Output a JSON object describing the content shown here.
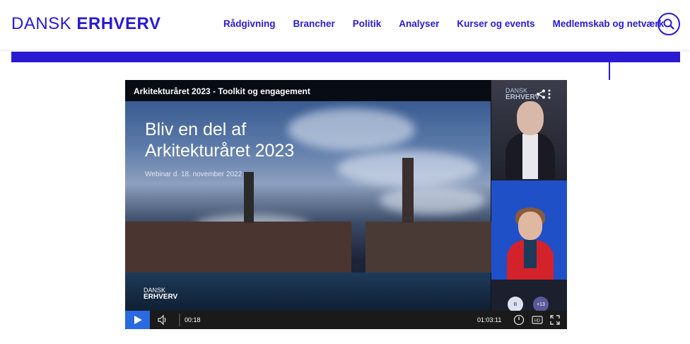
{
  "header": {
    "logo_light": "DANSK",
    "logo_bold": "ERHVERV",
    "nav": [
      {
        "label": "Rådgivning"
      },
      {
        "label": "Brancher"
      },
      {
        "label": "Politik"
      },
      {
        "label": "Analyser"
      },
      {
        "label": "Kurser og events"
      },
      {
        "label": "Medlemskab og netværk"
      }
    ],
    "search_icon": "search-icon"
  },
  "video": {
    "title": "Arkitekturåret 2023 - Toolkit og engagement",
    "slide_title_line1": "Bliv en del af",
    "slide_title_line2": "Arkitekturåret 2023",
    "slide_subtitle": "Webinar d. 18. november 2022",
    "slide_logo_light": "DANSK",
    "slide_logo_bold": "ERHVERV",
    "side_logo_light": "DANSK",
    "side_logo_bold": "ERHVERV",
    "participants": [
      {
        "initial": "B"
      },
      {
        "initial": "+13"
      }
    ],
    "current_time": "00:18",
    "total_time": "01:03:11",
    "progress": 0.005
  },
  "colors": {
    "brand": "#2a1ad2",
    "play_button": "#2a6ae0"
  }
}
